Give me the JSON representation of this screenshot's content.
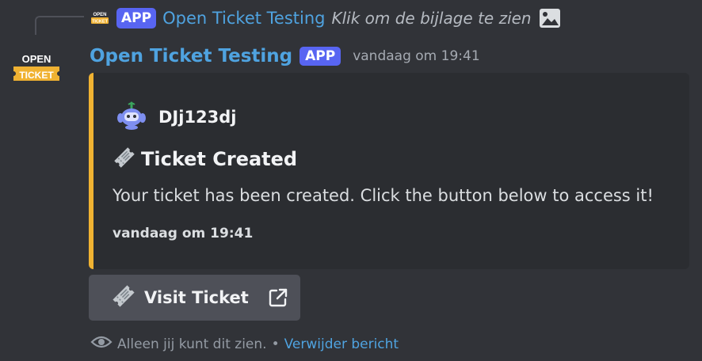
{
  "reply": {
    "badge": "APP",
    "author": "Open Ticket Testing",
    "text": "Klik om de bijlage te zien",
    "avatar_icon": "open-ticket-logo-icon",
    "attachment_icon": "image-icon"
  },
  "message": {
    "avatar_lines": [
      "OPEN",
      "TICKET"
    ],
    "author": "Open Ticket Testing",
    "badge": "APP",
    "timestamp": "vandaag om 19:41"
  },
  "embed": {
    "accent_color": "#f0b232",
    "author_name": "DJj123dj",
    "author_icon": "discord-bot-avatar-icon",
    "title_emoji": "ticket-icon",
    "title": "Ticket Created",
    "description": "Your ticket has been created. Click the button below to access it!",
    "footer": "vandaag om 19:41"
  },
  "button": {
    "label": "Visit Ticket",
    "icon": "ticket-icon",
    "trailing_icon": "external-link-icon"
  },
  "ephemeral": {
    "text": "Alleen jij kunt dit zien.",
    "separator": "•",
    "dismiss_label": "Verwijder bericht",
    "icon": "eye-icon"
  },
  "colors": {
    "background": "#313338",
    "embed_background": "#2b2d31",
    "author_link": "#4fa3e0",
    "badge": "#5865f2",
    "button": "#4e5058"
  }
}
